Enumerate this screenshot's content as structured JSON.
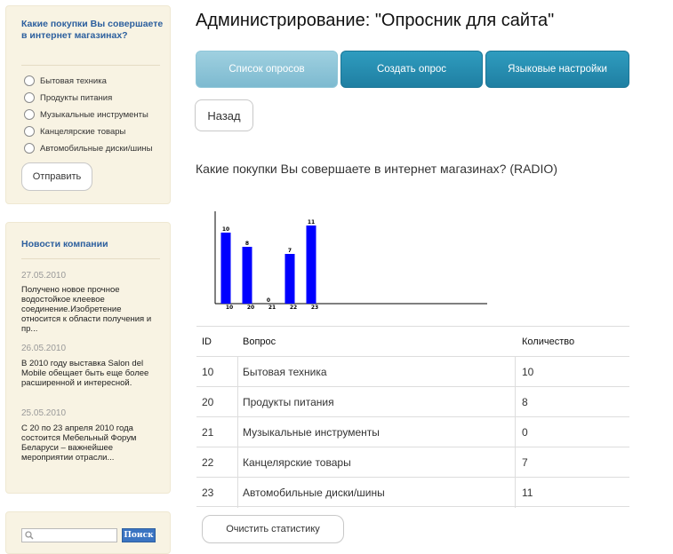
{
  "sidebar": {
    "poll": {
      "question": "Какие покупки Вы совершаете в интернет магазинах?",
      "options": [
        "Бытовая техника",
        "Продукты питания",
        "Музыкальные инструменты",
        "Канцелярские товары",
        "Автомобильные диски/шины"
      ],
      "submit_label": "Отправить"
    },
    "news": {
      "title": "Новости компании",
      "items": [
        {
          "date": "27.05.2010",
          "text": "Получено новое прочное водостойкое клеевое соединение.Изобретение относится к области получения и пр..."
        },
        {
          "date": "26.05.2010",
          "text": "В 2010 году выставка Salon del Mobile обещает быть еще более расширенной и интересной."
        },
        {
          "date": "25.05.2010",
          "text": "С 20 по 23 апреля 2010 года состоится Мебельный Форум Беларуси – важнейшее мероприятии отрасли..."
        }
      ]
    },
    "search": {
      "placeholder": "",
      "button_label": "Поиск"
    }
  },
  "main": {
    "title": "Администрирование: \"Опросник для сайта\"",
    "tabs": [
      {
        "label": "Список опросов",
        "active": true
      },
      {
        "label": "Создать опрос",
        "active": false
      },
      {
        "label": "Языковые настройки",
        "active": false
      }
    ],
    "back_label": "Назад",
    "question_title": "Какие покупки Вы совершаете в интернет магазинах? (RADIO)",
    "table": {
      "headers": [
        "ID",
        "Вопрос",
        "Количество"
      ],
      "rows": [
        [
          "10",
          "Бытовая техника",
          "10"
        ],
        [
          "20",
          "Продукты питания",
          "8"
        ],
        [
          "21",
          "Музыкальные инструменты",
          "0"
        ],
        [
          "22",
          "Канцелярские товары",
          "7"
        ],
        [
          "23",
          "Автомобильные диски/шины",
          "11"
        ]
      ]
    },
    "clear_label": "Очистить статистику"
  },
  "chart_data": {
    "type": "bar",
    "categories": [
      "10",
      "20",
      "21",
      "22",
      "23"
    ],
    "values": [
      10,
      8,
      0,
      7,
      11
    ],
    "ylim": [
      0,
      12
    ],
    "bar_color": "#0000ff"
  },
  "colors": {
    "link_blue": "#2c5f9e",
    "tab_active": "#8fc6d8",
    "tab_normal": "#2590b5",
    "panel_bg": "#f8f3e3"
  }
}
